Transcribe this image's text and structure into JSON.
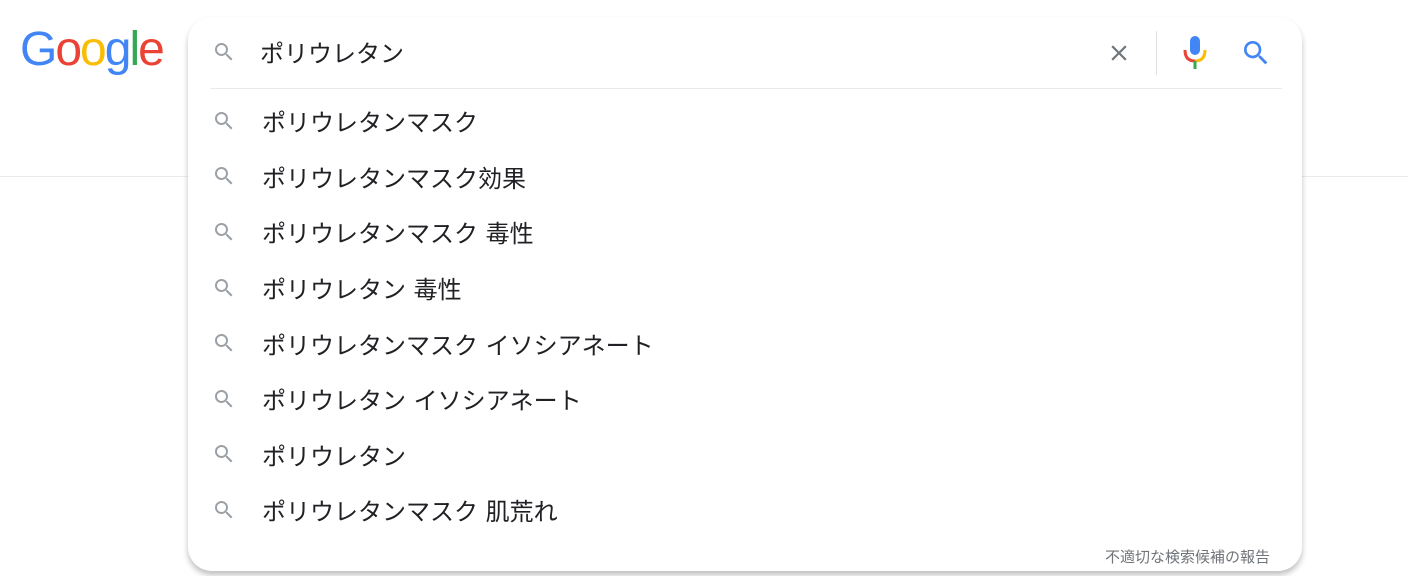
{
  "logo": {
    "letters": [
      "G",
      "o",
      "o",
      "g",
      "l",
      "e"
    ],
    "colors": [
      "#4285F4",
      "#EA4335",
      "#FBBC05",
      "#4285F4",
      "#34A853",
      "#EA4335"
    ]
  },
  "search": {
    "query": "ポリウレタン"
  },
  "icons": {
    "lead": "search-icon",
    "clear": "close-icon",
    "mic": "microphone-icon",
    "submit": "search-icon",
    "suggestion": "search-icon"
  },
  "colors": {
    "icon_gray": "#9aa0a6",
    "clear_gray": "#70757a",
    "accent_blue": "#4285F4",
    "mic_red": "#EA4335",
    "mic_yellow": "#FBBC05",
    "mic_green": "#34A853"
  },
  "suggestions": [
    "ポリウレタンマスク",
    "ポリウレタンマスク効果",
    "ポリウレタンマスク 毒性",
    "ポリウレタン 毒性",
    "ポリウレタンマスク イソシアネート",
    "ポリウレタン イソシアネート",
    "ポリウレタン",
    "ポリウレタンマスク 肌荒れ"
  ],
  "report_link": "不適切な検索候補の報告"
}
